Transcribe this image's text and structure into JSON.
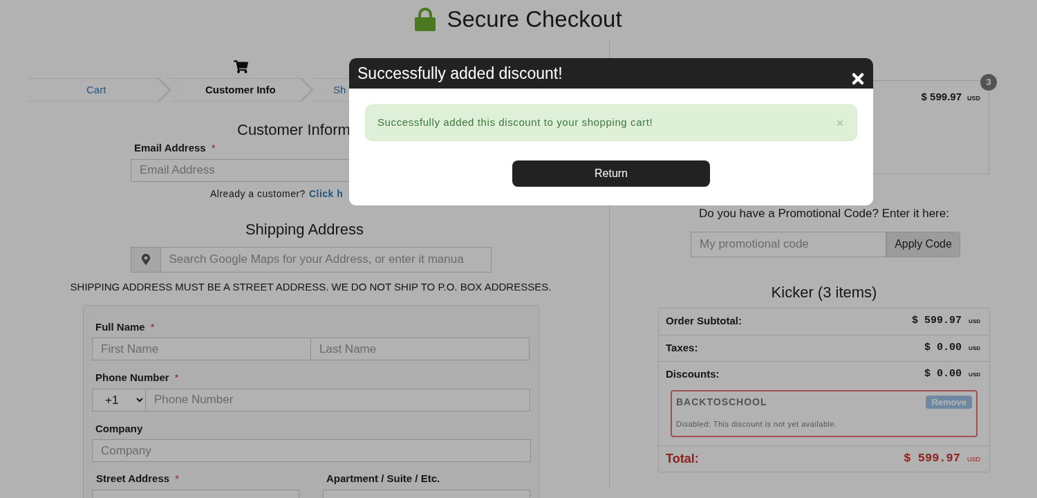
{
  "header": {
    "title": "Secure Checkout"
  },
  "steps": [
    {
      "label": "Cart",
      "selected": false
    },
    {
      "label": "Customer Info",
      "selected": true
    },
    {
      "label": "Sh",
      "selected": false
    }
  ],
  "customer_info": {
    "heading": "Customer Inform",
    "email": {
      "label": "Email Address",
      "required_mark": "*",
      "placeholder": "Email Address"
    },
    "login_prompt": "Already a customer?",
    "login_link": "Click h"
  },
  "shipping": {
    "heading": "Shipping Address",
    "search_placeholder": "Search Google Maps for your Address, or enter it manua",
    "notice": "SHIPPING ADDRESS MUST BE A STREET ADDRESS. WE DO NOT SHIP TO P.O. BOX ADDRESSES."
  },
  "form": {
    "full_name": {
      "label": "Full Name",
      "required_mark": "*",
      "placeholders": [
        "First Name",
        "Last Name"
      ]
    },
    "phone": {
      "label": "Phone Number",
      "required_mark": "*",
      "country_code": "+1",
      "placeholder": "Phone Number"
    },
    "company": {
      "label": "Company",
      "placeholder": "Company"
    },
    "street": {
      "label": "Street Address",
      "required_mark": "*"
    },
    "apartment": {
      "label": "Apartment / Suite / Etc."
    }
  },
  "cart_summary": {
    "badge": "3",
    "price": "$ 599.97",
    "currency": "USD"
  },
  "promo": {
    "prompt": "Do you have a Promotional Code? Enter it here:",
    "placeholder": "My promotional code",
    "button": "Apply Code"
  },
  "order": {
    "title": "Kicker (3 items)",
    "lines": [
      {
        "label": "Order Subtotal:",
        "amount": "$ 599.97",
        "currency": "USD"
      },
      {
        "label": "Taxes:",
        "amount": "$ 0.00",
        "currency": "USD"
      },
      {
        "label": "Discounts:",
        "amount": "$ 0.00",
        "currency": "USD"
      }
    ],
    "discount": {
      "code": "BACKTOSCHOOL",
      "button": "Remove",
      "disabled": true,
      "message": "Disabled: This discount is not yet available."
    },
    "total": {
      "label": "Total:",
      "amount": "$ 599.97",
      "currency": "USD"
    }
  },
  "modal": {
    "title": "Successfully added discount!",
    "alert": "Successfully added this discount to your shopping cart!",
    "button": "Return"
  }
}
